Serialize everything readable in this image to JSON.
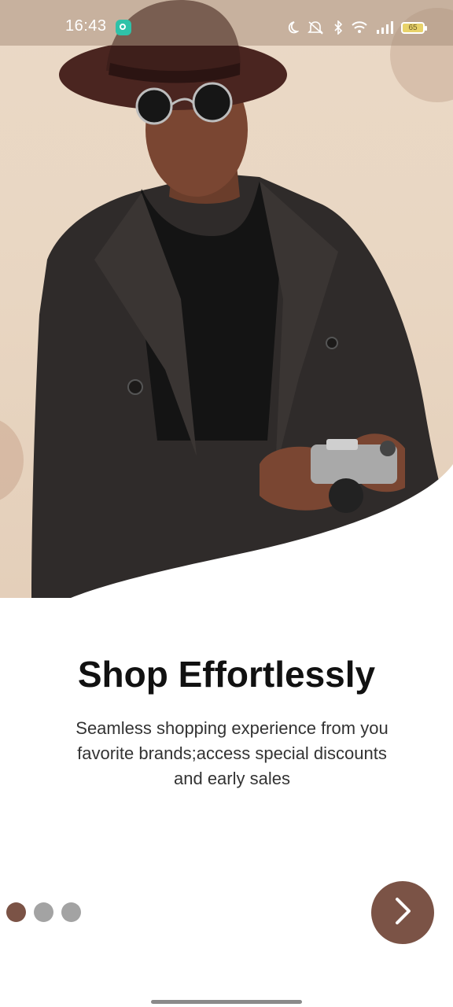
{
  "status_bar": {
    "time": "16:43",
    "battery": "65"
  },
  "onboarding": {
    "title": "Shop Effortlessly",
    "subtitle": "Seamless shopping experience from you favorite brands;access special discounts and early sales",
    "page_indicator": {
      "total": 3,
      "current": 1
    }
  },
  "icons": {
    "status": [
      "moon-icon",
      "mute-icon",
      "bluetooth-icon",
      "wifi-icon",
      "signal-icon",
      "battery-icon"
    ],
    "next": "chevron-right-icon"
  },
  "colors": {
    "accent": "#7b5346",
    "dot_inactive": "#a3a3a3",
    "hero_bg": "#ead8c6"
  }
}
